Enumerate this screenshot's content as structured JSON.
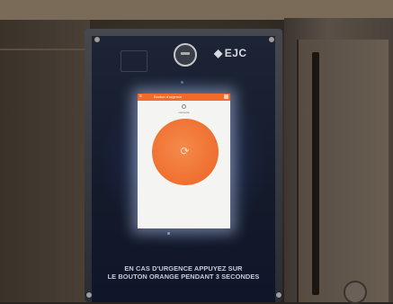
{
  "scene": {
    "brand": "EJC",
    "brand_icon": "diamond-logo-icon"
  },
  "tablet": {
    "app_title": "Bouton d'urgence",
    "status_text": "connecté",
    "menu_icon": "menu-icon",
    "action_icon": "settings-icon",
    "emergency_button_icon": "refresh-icon"
  },
  "notice": {
    "line1": "EN CAS D'URGENCE APPUYEZ SUR",
    "line2": "LE BOUTON ORANGE PENDANT 3 SECONDES"
  },
  "colors": {
    "accent": "#f26b2a",
    "button": "#ef6f30",
    "panel": "#141a2a"
  }
}
